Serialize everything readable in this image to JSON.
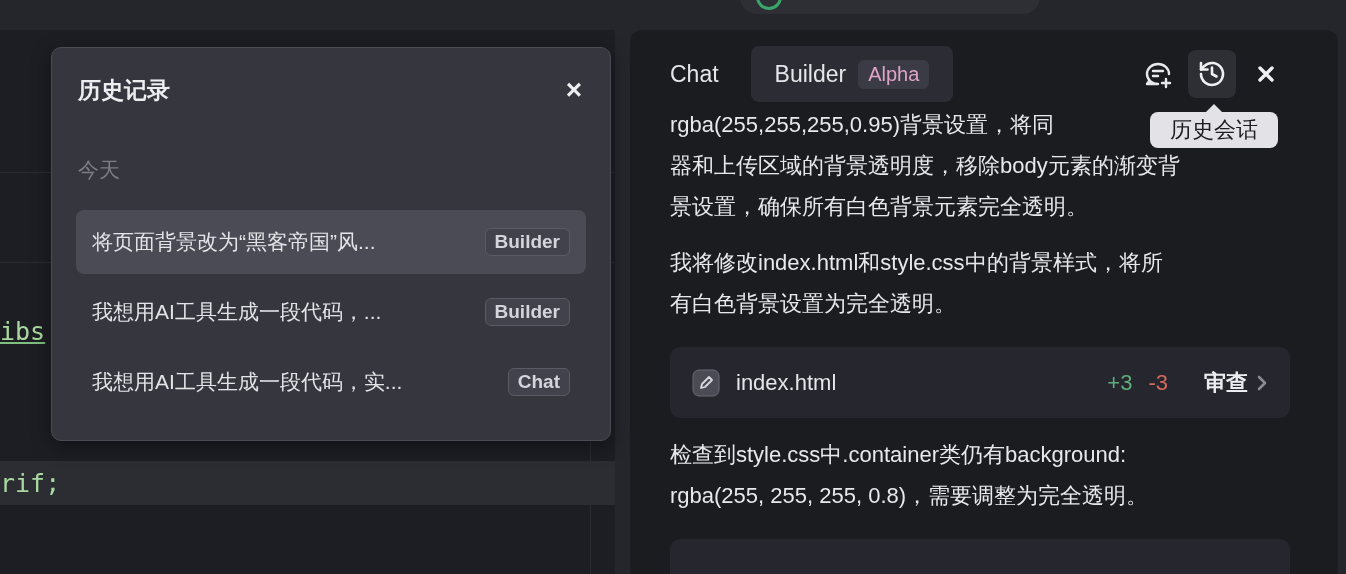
{
  "editor": {
    "code_lines": [
      {
        "text": "ibs",
        "kind": "link",
        "highlighted": false
      },
      {
        "text": "rif;",
        "kind": "plain",
        "highlighted": true
      }
    ]
  },
  "history_popup": {
    "title": "历史记录",
    "close": "×",
    "group": "今天",
    "items": [
      {
        "title": "将页面背景改为“黑客帝国”风...",
        "mode": "Builder",
        "selected": true
      },
      {
        "title": "我想用AI工具生成一段代码，...",
        "mode": "Builder",
        "selected": false
      },
      {
        "title": "我想用AI工具生成一段代码，实...",
        "mode": "Chat",
        "selected": false
      }
    ]
  },
  "chat_panel": {
    "tabs": [
      {
        "label": "Chat",
        "selected": false
      },
      {
        "label": "Builder",
        "badge": "Alpha",
        "selected": true
      }
    ],
    "toolbar": [
      {
        "kind": "new-chat",
        "active": false
      },
      {
        "kind": "history",
        "active": true
      },
      {
        "kind": "close",
        "active": false
      }
    ],
    "tooltip": "历史会话",
    "messages": [
      {
        "kind": "text",
        "lines": [
          "rgba(255,255,255,0.95)背景设置，将同",
          "器和上传区域的背景透明度，移除body元素的渐变背",
          "景设置，确保所有白色背景元素完全透明。"
        ]
      },
      {
        "kind": "text",
        "lines": [
          "我将修改index.html和style.css中的背景样式，将所",
          "有白色背景设置为完全透明。"
        ]
      },
      {
        "kind": "file",
        "name": "index.html",
        "added": "+3",
        "removed": "-3",
        "action": "审查"
      },
      {
        "kind": "text",
        "lines": [
          "检查到style.css中.container类仍有background:",
          "rgba(255, 255, 255, 0.8)，需要调整为完全透明。"
        ]
      },
      {
        "kind": "card"
      }
    ]
  }
}
